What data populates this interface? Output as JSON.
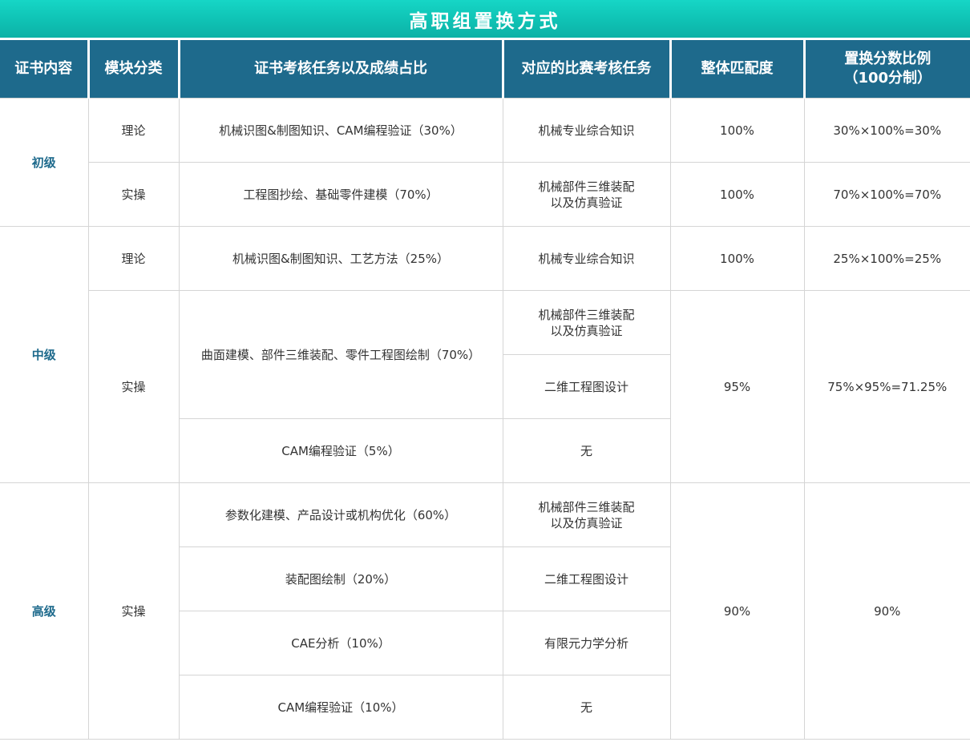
{
  "title": "高职组置换方式",
  "headers": {
    "col1": "证书内容",
    "col2": "模块分类",
    "col3": "证书考核任务以及成绩占比",
    "col4": "对应的比赛考核任务",
    "col5": "整体匹配度",
    "col6_line1": "置换分数比例",
    "col6_line2": "（100分制）"
  },
  "levels": {
    "junior": "初级",
    "middle": "中级",
    "senior": "高级"
  },
  "rows": {
    "r1": {
      "module": "理论",
      "task": "机械识图&制图知识、CAM编程验证（30%）",
      "competition": "机械专业综合知识",
      "match": "100%",
      "ratio": "30%×100%=30%"
    },
    "r2": {
      "module": "实操",
      "task": "工程图抄绘、基础零件建模（70%）",
      "competition_line1": "机械部件三维装配",
      "competition_line2": "以及仿真验证",
      "match": "100%",
      "ratio": "70%×100%=70%"
    },
    "r3": {
      "module": "理论",
      "task": "机械识图&制图知识、工艺方法（25%）",
      "competition": "机械专业综合知识",
      "match": "100%",
      "ratio": "25%×100%=25%"
    },
    "r4": {
      "module": "实操",
      "task": "曲面建模、部件三维装配、零件工程图绘制（70%）",
      "competition_line1": "机械部件三维装配",
      "competition_line2": "以及仿真验证",
      "match": "95%",
      "ratio": "75%×95%=71.25%"
    },
    "r5": {
      "competition": "二维工程图设计"
    },
    "r6": {
      "task": "CAM编程验证（5%）",
      "competition": "无"
    },
    "r7": {
      "module": "实操",
      "task": "参数化建模、产品设计或机构优化（60%）",
      "competition_line1": "机械部件三维装配",
      "competition_line2": "以及仿真验证",
      "match": "90%",
      "ratio": "90%"
    },
    "r8": {
      "task": "装配图绘制（20%）",
      "competition": "二维工程图设计"
    },
    "r9": {
      "task": "CAE分析（10%）",
      "competition": "有限元力学分析"
    },
    "r10": {
      "task": "CAM编程验证（10%）",
      "competition": "无"
    }
  }
}
